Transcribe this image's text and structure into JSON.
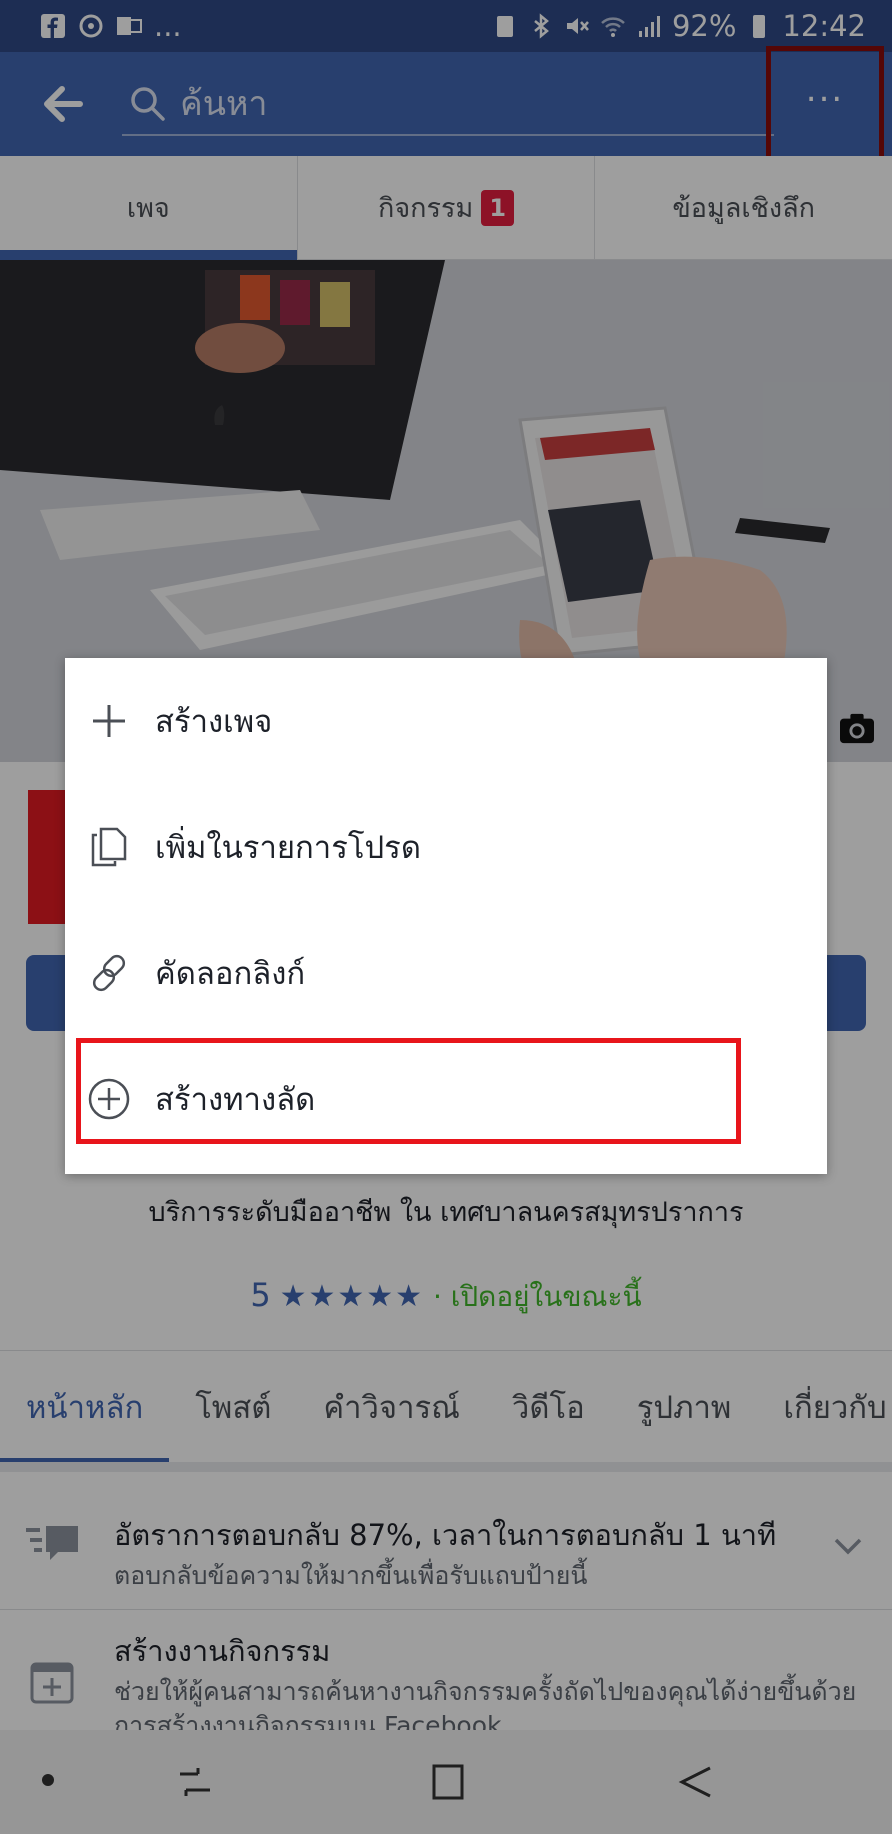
{
  "status_bar": {
    "left_more": "...",
    "battery": "92%",
    "time": "12:42"
  },
  "header": {
    "search_placeholder": "ค้นหา",
    "more_label": "..."
  },
  "page_tabs": [
    {
      "label": "เพจ",
      "active": true
    },
    {
      "label": "กิจกรรม",
      "badge": "1"
    },
    {
      "label": "ข้อมูลเชิงลึก"
    }
  ],
  "page_info": {
    "service": "บริการระดับมืออาชีพ ใน เทศบาลนครสมุทรปราการ",
    "rating_value": "5",
    "rating_stars": 5,
    "open_status": "· เปิดอยู่ในขณะนี้"
  },
  "section_tabs": [
    "หน้าหลัก",
    "โพสต์",
    "คำวิจารณ์",
    "วิดีโอ",
    "รูปภาพ",
    "เกี่ยวกับ"
  ],
  "insight": {
    "title": "อัตราการตอบกลับ 87%, เวลาในการตอบกลับ 1 นาที",
    "subtitle": "ตอบกลับข้อความให้มากขึ้นเพื่อรับแถบป้ายนี้"
  },
  "event_card": {
    "title": "สร้างงานกิจกรรม",
    "line1": "ช่วยให้ผู้คนสามารถค้นหางานกิจกรรมครั้งถัดไปของคุณได้ง่ายขึ้นด้วย",
    "line2": "การสร้างงานกิจกรรมบน Facebook"
  },
  "menu": {
    "items": [
      {
        "icon": "plus-icon",
        "label": "สร้างเพจ"
      },
      {
        "icon": "copy-icon",
        "label": "เพิ่มในรายการโปรด"
      },
      {
        "icon": "link-icon",
        "label": "คัดลอกลิงก์"
      },
      {
        "icon": "circle-plus-icon",
        "label": "สร้างทางลัด"
      }
    ]
  },
  "colors": {
    "brand": "#4267b2",
    "highlight": "#e8151b",
    "open_green": "#42b72a",
    "badge_red": "#e41e3f"
  }
}
